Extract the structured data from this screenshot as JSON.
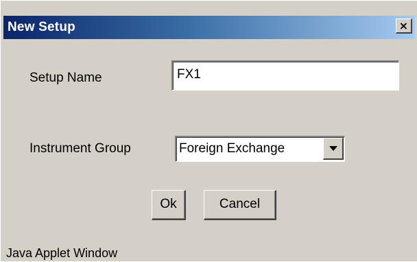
{
  "dialog": {
    "title": "New Setup",
    "close_glyph": "×",
    "close_icon": "close-icon"
  },
  "form": {
    "setup_name_label": "Setup Name",
    "setup_name_value": "FX1",
    "instrument_group_label": "Instrument Group",
    "instrument_group_selected": "Foreign Exchange",
    "dropdown_icon": "chevron-down-icon"
  },
  "buttons": {
    "ok_label": "Ok",
    "cancel_label": "Cancel"
  },
  "status_bar": {
    "text": "Java Applet Window"
  },
  "colors": {
    "title_gradient_start": "#0a246a",
    "title_gradient_end": "#a6caf0",
    "window_face": "#d4d0c8"
  }
}
